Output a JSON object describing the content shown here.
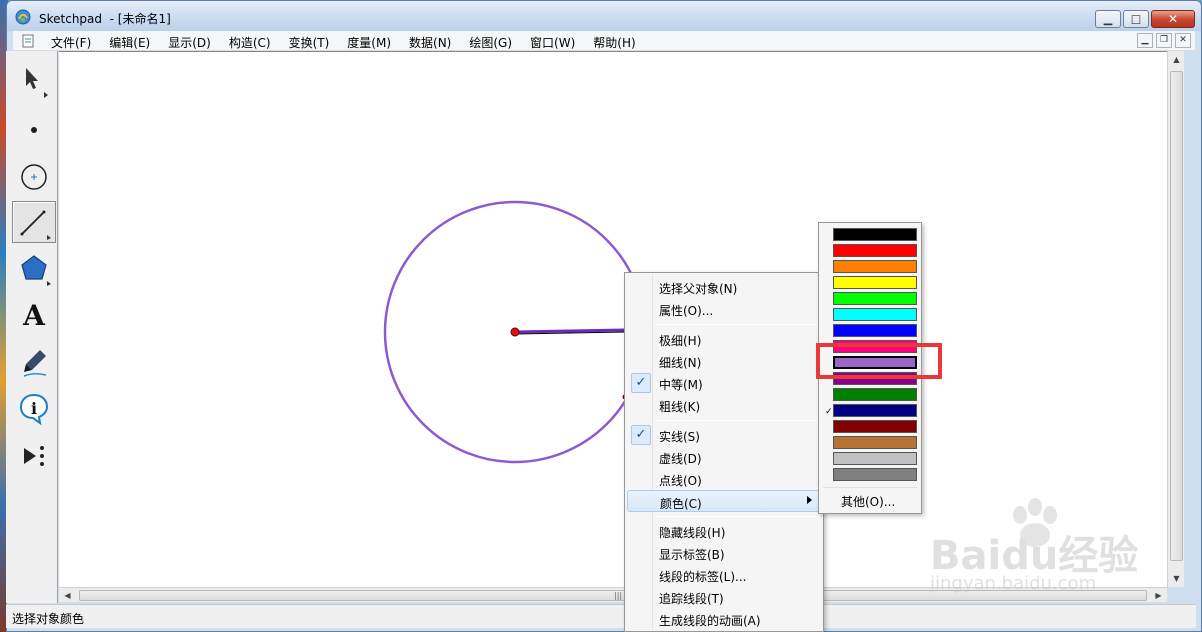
{
  "window": {
    "title": "Sketchpad  - [未命名1]"
  },
  "menubar": {
    "items": [
      {
        "label": "文件(F)"
      },
      {
        "label": "编辑(E)"
      },
      {
        "label": "显示(D)"
      },
      {
        "label": "构造(C)"
      },
      {
        "label": "变换(T)"
      },
      {
        "label": "度量(M)"
      },
      {
        "label": "数据(N)"
      },
      {
        "label": "绘图(G)"
      },
      {
        "label": "窗口(W)"
      },
      {
        "label": "帮助(H)"
      }
    ]
  },
  "toolbox": {
    "tools": [
      {
        "name": "selection-arrow-tool",
        "icon": "arrow-icon"
      },
      {
        "name": "point-tool",
        "icon": "point-icon"
      },
      {
        "name": "compass-tool",
        "icon": "circle-icon"
      },
      {
        "name": "straightedge-tool",
        "icon": "segment-icon",
        "active": true
      },
      {
        "name": "polygon-tool",
        "icon": "pentagon-icon"
      },
      {
        "name": "text-tool",
        "icon": "text-a-icon",
        "glyph": "A"
      },
      {
        "name": "marker-tool",
        "icon": "marker-pen-icon"
      },
      {
        "name": "information-tool",
        "icon": "info-icon",
        "glyph": "i"
      },
      {
        "name": "custom-tool",
        "icon": "custom-tool-icon"
      }
    ]
  },
  "canvas": {
    "circle_color": "#8a5cd0",
    "segment_color": "#6a2cc0",
    "point_color": "#e01010"
  },
  "context_menu": {
    "items": [
      {
        "label": "选择父对象(N)",
        "checked": false
      },
      {
        "label": "属性(O)...",
        "checked": false
      },
      {
        "label": "极细(H)",
        "checked": false
      },
      {
        "label": "细线(N)",
        "checked": false
      },
      {
        "label": "中等(M)",
        "checked": true
      },
      {
        "label": "粗线(K)",
        "checked": false
      },
      {
        "label": "实线(S)",
        "checked": true
      },
      {
        "label": "虚线(D)",
        "checked": false
      },
      {
        "label": "点线(O)",
        "checked": false
      },
      {
        "label": "颜色(C)",
        "checked": false,
        "submenu": true,
        "highlighted": true
      },
      {
        "label": "隐藏线段(H)",
        "checked": false
      },
      {
        "label": "显示标签(B)",
        "checked": false
      },
      {
        "label": "线段的标签(L)...",
        "checked": false
      },
      {
        "label": "追踪线段(T)",
        "checked": false
      },
      {
        "label": "生成线段的动画(A)",
        "checked": false
      }
    ],
    "check_glyph": "✓"
  },
  "color_menu": {
    "swatches": [
      {
        "color": "#000000"
      },
      {
        "color": "#ff0000"
      },
      {
        "color": "#ff8000"
      },
      {
        "color": "#ffff00"
      },
      {
        "color": "#00ff00"
      },
      {
        "color": "#00ffff"
      },
      {
        "color": "#0000ff"
      },
      {
        "color": "#ff0080"
      },
      {
        "color": "#9966cc",
        "selected": true
      },
      {
        "color": "#8b008b"
      },
      {
        "color": "#008000"
      },
      {
        "color": "#000080"
      },
      {
        "color": "#800000"
      },
      {
        "color": "#b87333"
      },
      {
        "color": "#c0c0c0"
      },
      {
        "color": "#808080"
      }
    ],
    "other_label": "其他(O)...",
    "highlight_color": "#e8383a"
  },
  "statusbar": {
    "text": "选择对象颜色"
  },
  "watermark": {
    "line1": "Baidu经验",
    "line2": "jingyan.baidu.com"
  }
}
